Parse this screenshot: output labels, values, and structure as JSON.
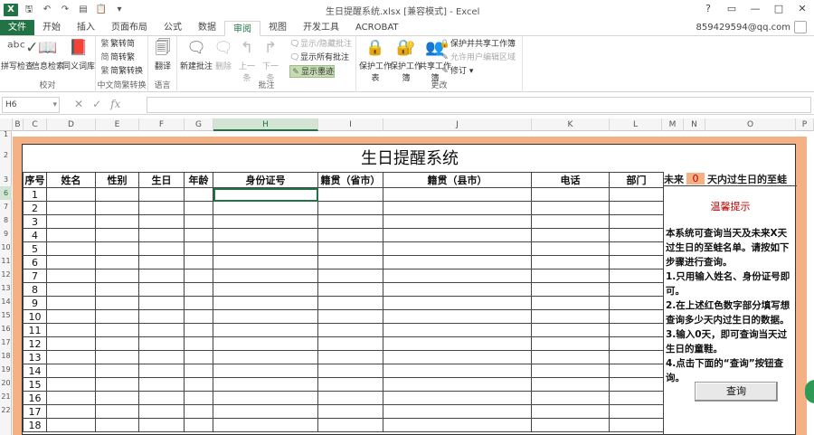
{
  "window": {
    "title": "生日提醒系统.xlsx [兼容模式] - Excel",
    "controls": [
      "?",
      "▭",
      "—",
      "□",
      "✕"
    ]
  },
  "qat_icons": [
    "excel-icon",
    "save-icon",
    "undo-icon",
    "redo-icon",
    "open-icon",
    "paste-icon",
    "more-icon"
  ],
  "tabs": [
    {
      "label": "文件"
    },
    {
      "label": "开始"
    },
    {
      "label": "插入"
    },
    {
      "label": "页面布局"
    },
    {
      "label": "公式"
    },
    {
      "label": "数据"
    },
    {
      "label": "审阅"
    },
    {
      "label": "视图"
    },
    {
      "label": "开发工具"
    },
    {
      "label": "ACROBAT"
    }
  ],
  "active_tab": "审阅",
  "user": {
    "name": "859429594@qq.com"
  },
  "ribbon": {
    "proofing": {
      "label": "校对",
      "buttons": [
        {
          "label": "拼写检查",
          "icon": "abc-check-icon"
        },
        {
          "label": "信息检索",
          "icon": "research-icon"
        },
        {
          "label": "同义词库",
          "icon": "thesaurus-icon"
        }
      ]
    },
    "chinese": {
      "label": "中文简繁转换",
      "buttons": [
        {
          "label": "繁转简",
          "icon": "convert-icon"
        },
        {
          "label": "简转繁",
          "icon": "convert-icon"
        },
        {
          "label": "简繁转换",
          "icon": "convert-icon"
        }
      ]
    },
    "language": {
      "label": "语言",
      "buttons": [
        {
          "label": "翻译",
          "icon": "translate-icon"
        }
      ]
    },
    "comments": {
      "label": "批注",
      "buttons": [
        {
          "label": "新建批注",
          "icon": "new-comment-icon"
        },
        {
          "label": "删除",
          "icon": "delete-comment-icon"
        },
        {
          "label": "上一条",
          "icon": "prev-comment-icon"
        },
        {
          "label": "下一条",
          "icon": "next-comment-icon"
        }
      ],
      "small": [
        {
          "label": "显示/隐藏批注"
        },
        {
          "label": "显示所有批注"
        },
        {
          "label": "显示墨迹"
        }
      ]
    },
    "changes": {
      "label": "更改",
      "buttons": [
        {
          "label": "保护工作表",
          "icon": "protect-sheet-icon"
        },
        {
          "label": "保护工作簿",
          "icon": "protect-book-icon"
        },
        {
          "label": "共享工作簿",
          "icon": "share-book-icon"
        }
      ],
      "small": [
        {
          "label": "保护并共享工作簿"
        },
        {
          "label": "允许用户编辑区域"
        },
        {
          "label": "修订 ▾"
        }
      ]
    }
  },
  "formula_bar": {
    "name_box": "H6",
    "formula": ""
  },
  "columns": [
    "B",
    "C",
    "D",
    "E",
    "F",
    "G",
    "H",
    "I",
    "J",
    "K",
    "L",
    "M",
    "N",
    "O",
    "P"
  ],
  "selected_column": "H",
  "rows": [
    "1",
    "2",
    "3",
    "4",
    "5",
    "6",
    "7",
    "8",
    "9",
    "10",
    "11",
    "12",
    "13",
    "14",
    "15",
    "16",
    "17",
    "18",
    "19",
    "20",
    "21",
    "22"
  ],
  "selected_row": "6",
  "sheet": {
    "title": "生日提醒系统",
    "headers": [
      "序号",
      "姓名",
      "性别",
      "生日",
      "年龄",
      "身份证号",
      "籍贯（省市）",
      "籍贯（县市）",
      "电话",
      "部门"
    ],
    "row_numbers": [
      "1",
      "2",
      "3",
      "4",
      "5",
      "6",
      "7",
      "8",
      "9",
      "10",
      "11",
      "12",
      "13",
      "14",
      "15",
      "16",
      "17",
      "18"
    ],
    "side_header": {
      "prefix": "未来",
      "value": "0",
      "suffix": "天内过生日的至蛙"
    },
    "tips_title": "温馨提示",
    "tips": [
      "本系统可查询当天及未来X天过生日的至蛙名单。请按如下步骤进行查询。",
      "1.只用输入姓名、身份证号即可。",
      "2.在上述红色数字部分填写想查询多少天内过生日的数据。",
      "3.输入0天，即可查询当天过生日的童鞋。",
      "4.点击下面的“查询”按钮查询。"
    ],
    "query_button": "查询"
  },
  "colors": {
    "excel_green": "#217346",
    "frame_orange": "#f4b183",
    "tip_red": "#c00000"
  }
}
